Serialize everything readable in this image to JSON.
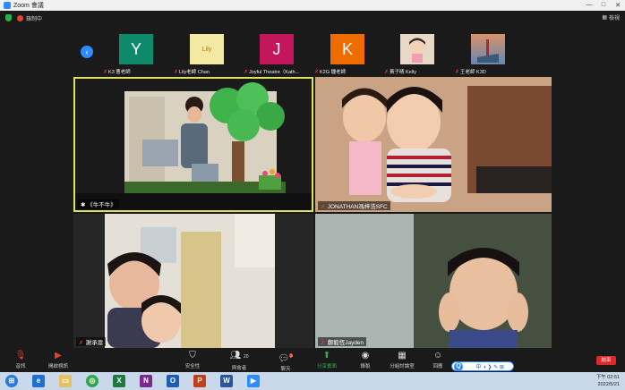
{
  "window": {
    "title": "Zoom 會議",
    "controls": [
      "—",
      "□",
      "✕"
    ]
  },
  "meeting": {
    "recording_label": "錄制中",
    "gallery_label": "檢視"
  },
  "thumbnails": [
    {
      "initial": "Y",
      "color": "#0e8a6b",
      "name": "K3 曹老師"
    },
    {
      "initial": "",
      "color": "#f4e9a3",
      "name": "Lily老師 Chan"
    },
    {
      "initial": "J",
      "color": "#c2185b",
      "name": "Joyful Theatre（Kath..."
    },
    {
      "initial": "K",
      "color": "#ef6c00",
      "name": "K2G 鍾老師"
    },
    {
      "initial": "",
      "color": "#e8d8c8",
      "name": "黃子晴 Kelly"
    },
    {
      "initial": "",
      "color": "#c07040",
      "name": "王老師 K3D"
    }
  ],
  "tiles": {
    "speaker": "《牛不牛》",
    "jonathan": "JONATHAN馮梓浩SFC",
    "xie": "謝承恩",
    "jayden": "鄭懿恆Jayden"
  },
  "toolbar": {
    "audio": "音訊",
    "video": "開啟視訊",
    "security": "安全性",
    "participants": "與會者",
    "participants_count": "20",
    "chat": "聊天",
    "chat_badge": "2",
    "share": "分享畫面",
    "record": "錄製",
    "apps": "分組討論室",
    "reactions": "回應",
    "end": "結束"
  },
  "ime": {
    "label": "中 ◑ ❯ ✎ ⊞"
  },
  "clock": {
    "time": "下午 02:51",
    "date": "2022/5/21"
  }
}
